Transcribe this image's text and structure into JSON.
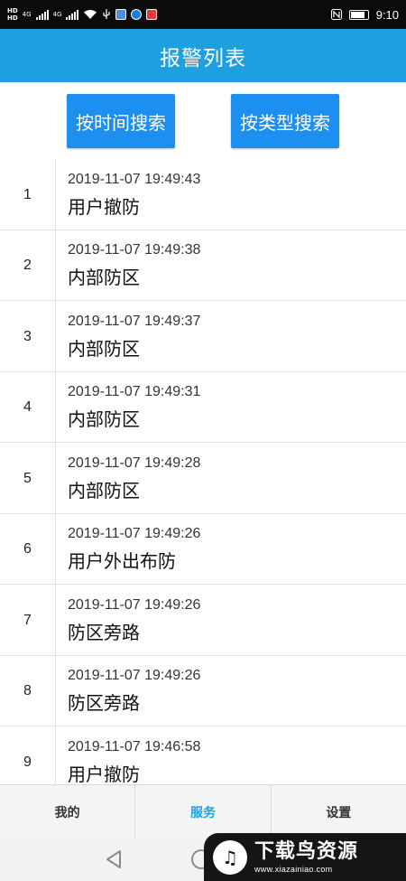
{
  "status_bar": {
    "hd_top": "HD",
    "hd_bottom": "HD",
    "net1": "4G",
    "net2": "4G",
    "time": "9:10",
    "battery_level": 0.85
  },
  "header": {
    "title": "报警列表"
  },
  "search": {
    "by_time_label": "按时间搜索",
    "by_type_label": "按类型搜索"
  },
  "alarms": [
    {
      "index": "1",
      "time": "2019-11-07 19:49:43",
      "type": "用户撤防"
    },
    {
      "index": "2",
      "time": "2019-11-07 19:49:38",
      "type": "内部防区"
    },
    {
      "index": "3",
      "time": "2019-11-07 19:49:37",
      "type": "内部防区"
    },
    {
      "index": "4",
      "time": "2019-11-07 19:49:31",
      "type": "内部防区"
    },
    {
      "index": "5",
      "time": "2019-11-07 19:49:28",
      "type": "内部防区"
    },
    {
      "index": "6",
      "time": "2019-11-07 19:49:26",
      "type": "用户外出布防"
    },
    {
      "index": "7",
      "time": "2019-11-07 19:49:26",
      "type": "防区旁路"
    },
    {
      "index": "8",
      "time": "2019-11-07 19:49:26",
      "type": "防区旁路"
    },
    {
      "index": "9",
      "time": "2019-11-07 19:46:58",
      "type": "用户撤防"
    }
  ],
  "tabs": {
    "mine": "我的",
    "service": "服务",
    "settings": "设置",
    "active": "service"
  },
  "watermark": {
    "name": "下载鸟资源",
    "url": "www.xiazainiao.com"
  },
  "colors": {
    "header_bg": "#1e9fe0",
    "button_bg": "#1d8ff0",
    "active_tab": "#1e9fe0"
  }
}
